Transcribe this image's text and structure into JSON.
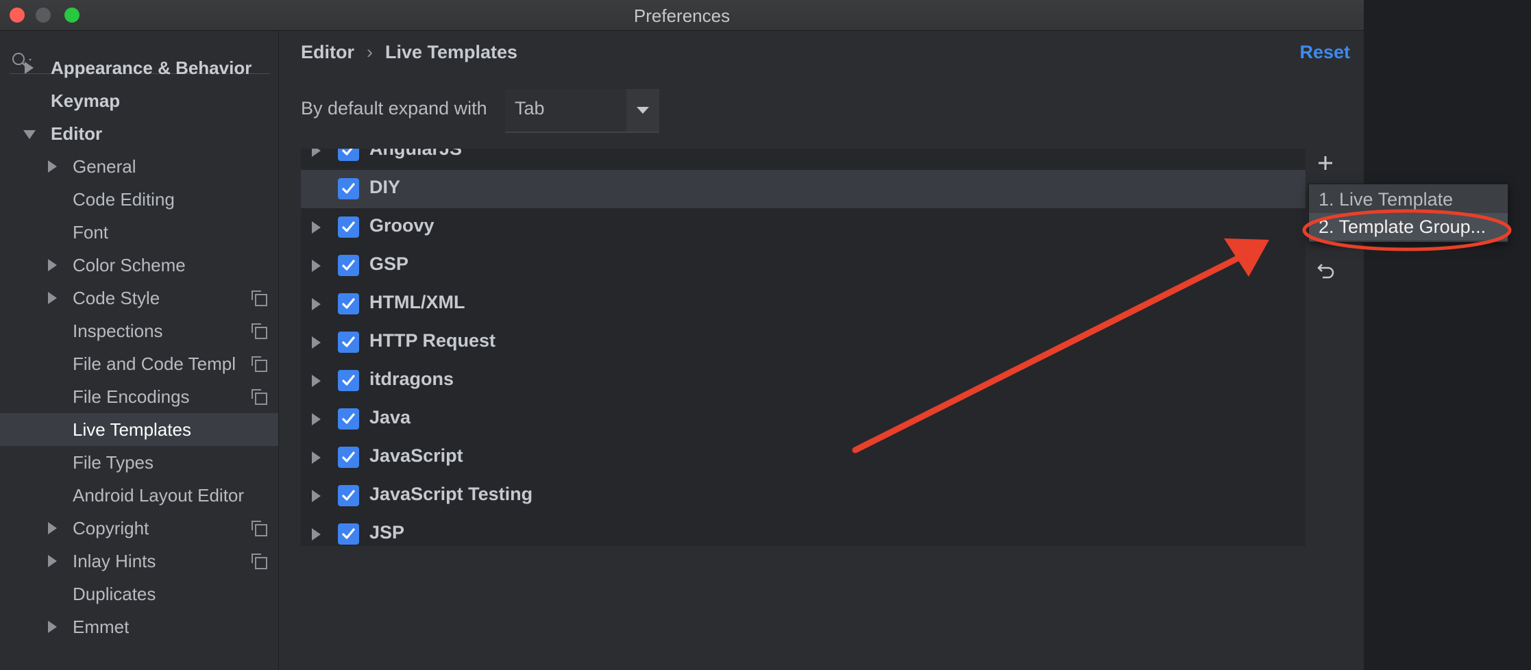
{
  "window": {
    "title": "Preferences"
  },
  "sidebar": {
    "search_placeholder": "",
    "items": [
      {
        "label": "Appearance & Behavior",
        "level": 0,
        "expander": "collapsed",
        "bold": true,
        "copy_icon": false
      },
      {
        "label": "Keymap",
        "level": 0,
        "expander": "none",
        "bold": true,
        "copy_icon": false
      },
      {
        "label": "Editor",
        "level": 0,
        "expander": "expanded",
        "bold": true,
        "copy_icon": false
      },
      {
        "label": "General",
        "level": 1,
        "expander": "collapsed",
        "bold": false,
        "copy_icon": false
      },
      {
        "label": "Code Editing",
        "level": 1,
        "expander": "none",
        "bold": false,
        "copy_icon": false
      },
      {
        "label": "Font",
        "level": 1,
        "expander": "none",
        "bold": false,
        "copy_icon": false
      },
      {
        "label": "Color Scheme",
        "level": 1,
        "expander": "collapsed",
        "bold": false,
        "copy_icon": false
      },
      {
        "label": "Code Style",
        "level": 1,
        "expander": "collapsed",
        "bold": false,
        "copy_icon": true
      },
      {
        "label": "Inspections",
        "level": 1,
        "expander": "none",
        "bold": false,
        "copy_icon": true
      },
      {
        "label": "File and Code Templ",
        "level": 1,
        "expander": "none",
        "bold": false,
        "copy_icon": true
      },
      {
        "label": "File Encodings",
        "level": 1,
        "expander": "none",
        "bold": false,
        "copy_icon": true
      },
      {
        "label": "Live Templates",
        "level": 1,
        "expander": "none",
        "bold": false,
        "copy_icon": false,
        "selected": true
      },
      {
        "label": "File Types",
        "level": 1,
        "expander": "none",
        "bold": false,
        "copy_icon": false
      },
      {
        "label": "Android Layout Editor",
        "level": 1,
        "expander": "none",
        "bold": false,
        "copy_icon": false
      },
      {
        "label": "Copyright",
        "level": 1,
        "expander": "collapsed",
        "bold": false,
        "copy_icon": true
      },
      {
        "label": "Inlay Hints",
        "level": 1,
        "expander": "collapsed",
        "bold": false,
        "copy_icon": true
      },
      {
        "label": "Duplicates",
        "level": 1,
        "expander": "none",
        "bold": false,
        "copy_icon": false
      },
      {
        "label": "Emmet",
        "level": 1,
        "expander": "collapsed",
        "bold": false,
        "copy_icon": false
      }
    ]
  },
  "header": {
    "breadcrumb": [
      "Editor",
      "Live Templates"
    ],
    "separator": "›",
    "reset_label": "Reset"
  },
  "expand": {
    "label": "By default expand with",
    "value": "Tab"
  },
  "template_groups": [
    {
      "label": "AngularJS",
      "checked": true,
      "expander": true,
      "partial": true
    },
    {
      "label": "DIY",
      "checked": true,
      "expander": false,
      "highlighted": true
    },
    {
      "label": "Groovy",
      "checked": true,
      "expander": true
    },
    {
      "label": "GSP",
      "checked": true,
      "expander": true
    },
    {
      "label": "HTML/XML",
      "checked": true,
      "expander": true
    },
    {
      "label": "HTTP Request",
      "checked": true,
      "expander": true
    },
    {
      "label": "itdragons",
      "checked": true,
      "expander": true
    },
    {
      "label": "Java",
      "checked": true,
      "expander": true
    },
    {
      "label": "JavaScript",
      "checked": true,
      "expander": true
    },
    {
      "label": "JavaScript Testing",
      "checked": true,
      "expander": true
    },
    {
      "label": "JSP",
      "checked": true,
      "expander": true
    }
  ],
  "toolbar": {
    "add_icon": "plus-icon",
    "undo_icon": "undo-icon"
  },
  "add_menu": {
    "items": [
      {
        "label": "1. Live Template",
        "selected": false
      },
      {
        "label": "2. Template Group...",
        "selected": true
      }
    ]
  },
  "annotation": {
    "arrow_color": "#e8402a",
    "ellipse_color": "#e8402a"
  },
  "colors": {
    "accent": "#3f83f0",
    "link": "#3d8bf0",
    "background": "#2b2d31"
  }
}
